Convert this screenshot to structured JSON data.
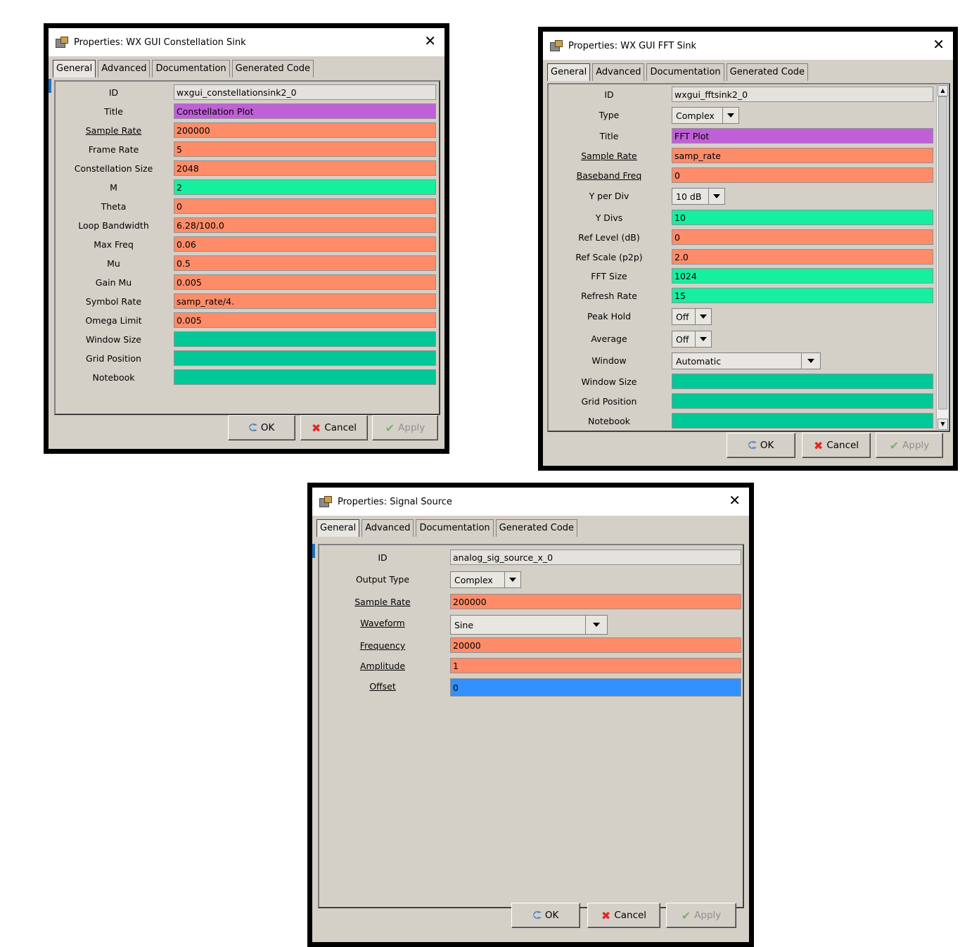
{
  "dlg1": {
    "title": "Properties: WX GUI Constellation Sink",
    "tabs": [
      "General",
      "Advanced",
      "Documentation",
      "Generated Code"
    ],
    "fields": [
      {
        "label": "ID",
        "value": "wxgui_constellationsink2_0"
      },
      {
        "label": "Title",
        "value": "Constellation Plot"
      },
      {
        "label": "Sample Rate",
        "value": "200000"
      },
      {
        "label": "Frame Rate",
        "value": "5"
      },
      {
        "label": "Constellation Size",
        "value": "2048"
      },
      {
        "label": "M",
        "value": "2"
      },
      {
        "label": "Theta",
        "value": "0"
      },
      {
        "label": "Loop Bandwidth",
        "value": "6.28/100.0"
      },
      {
        "label": "Max Freq",
        "value": "0.06"
      },
      {
        "label": "Mu",
        "value": "0.5"
      },
      {
        "label": "Gain Mu",
        "value": "0.005"
      },
      {
        "label": "Symbol Rate",
        "value": "samp_rate/4."
      },
      {
        "label": "Omega Limit",
        "value": "0.005"
      },
      {
        "label": "Window Size",
        "value": ""
      },
      {
        "label": "Grid Position",
        "value": ""
      },
      {
        "label": "Notebook",
        "value": ""
      }
    ]
  },
  "dlg2": {
    "title": "Properties: WX GUI FFT Sink",
    "tabs": [
      "General",
      "Advanced",
      "Documentation",
      "Generated Code"
    ],
    "fields": [
      {
        "label": "ID",
        "value": "wxgui_fftsink2_0"
      },
      {
        "label": "Type",
        "value": "Complex"
      },
      {
        "label": "Title",
        "value": "FFT Plot"
      },
      {
        "label": "Sample Rate",
        "value": "samp_rate"
      },
      {
        "label": "Baseband Freq",
        "value": "0"
      },
      {
        "label": "Y per Div",
        "value": "10 dB"
      },
      {
        "label": "Y Divs",
        "value": "10"
      },
      {
        "label": "Ref Level (dB)",
        "value": "0"
      },
      {
        "label": "Ref Scale (p2p)",
        "value": "2.0"
      },
      {
        "label": "FFT Size",
        "value": "1024"
      },
      {
        "label": "Refresh Rate",
        "value": "15"
      },
      {
        "label": "Peak Hold",
        "value": "Off"
      },
      {
        "label": "Average",
        "value": "Off"
      },
      {
        "label": "Window",
        "value": "Automatic"
      },
      {
        "label": "Window Size",
        "value": ""
      },
      {
        "label": "Grid Position",
        "value": ""
      },
      {
        "label": "Notebook",
        "value": ""
      }
    ]
  },
  "dlg3": {
    "title": "Properties: Signal Source",
    "tabs": [
      "General",
      "Advanced",
      "Documentation",
      "Generated Code"
    ],
    "fields": [
      {
        "label": "ID",
        "value": "analog_sig_source_x_0"
      },
      {
        "label": "Output Type",
        "value": "Complex"
      },
      {
        "label": "Sample Rate",
        "value": "200000"
      },
      {
        "label": "Waveform",
        "value": "Sine"
      },
      {
        "label": "Frequency",
        "value": "20000"
      },
      {
        "label": "Amplitude",
        "value": "1"
      },
      {
        "label": "Offset",
        "value": "0"
      }
    ]
  },
  "buttons": {
    "ok": "OK",
    "cancel": "Cancel",
    "apply": "Apply"
  },
  "colors": {
    "purple": "#c060d8",
    "orange": "#ff8c69",
    "green": "#14f0a0",
    "teal": "#00c896",
    "blue": "#3390ff",
    "dialog_bg": "#d4d0c8"
  }
}
